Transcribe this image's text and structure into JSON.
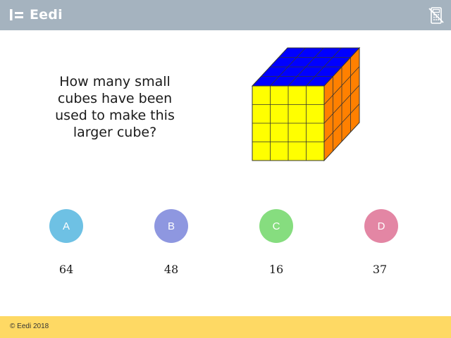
{
  "header": {
    "brand": "Eedi",
    "logo_icon": "eedi-logo-icon",
    "calculator_icon": "calculator-crossed-icon",
    "colors": {
      "background": "#a5b3bf",
      "text": "#ffffff"
    }
  },
  "question": {
    "text": "How many small cubes have been used to make this larger cube?"
  },
  "figure": {
    "description_icon": "cube-4x4x4-icon",
    "colors": {
      "front": "#ffff00",
      "top": "#0000ff",
      "side": "#ff8000",
      "edge": "#333333"
    }
  },
  "options": [
    {
      "letter": "A",
      "answer": "64",
      "color": "#6ec1e4"
    },
    {
      "letter": "B",
      "answer": "48",
      "color": "#8e97e0"
    },
    {
      "letter": "C",
      "answer": "16",
      "color": "#86dd7f"
    },
    {
      "letter": "D",
      "answer": "37",
      "color": "#e386a4"
    }
  ],
  "footer": {
    "copyright": "© Eedi 2018",
    "color": "#fed964"
  }
}
